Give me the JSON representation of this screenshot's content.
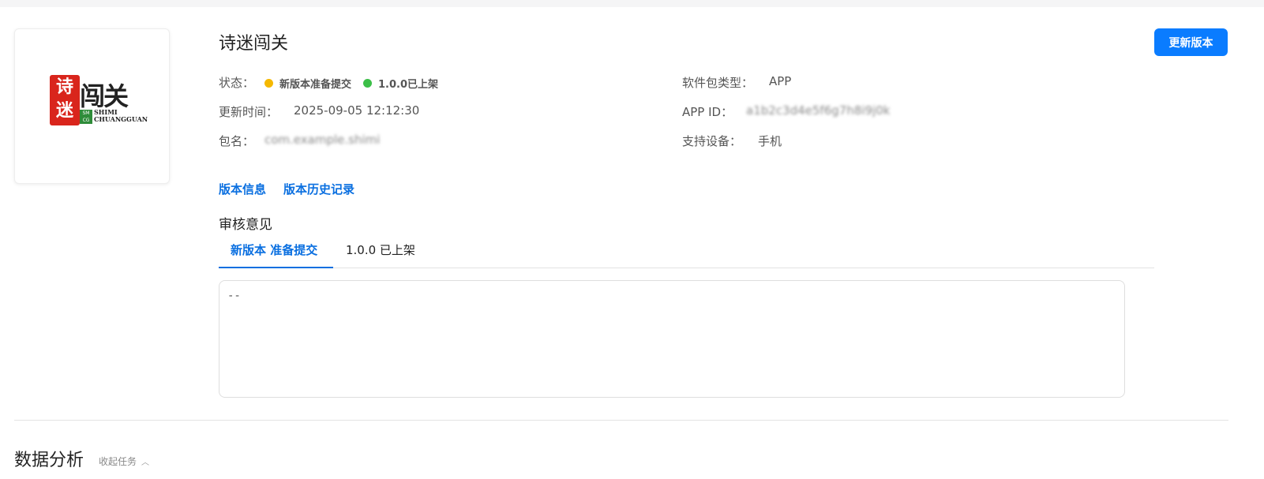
{
  "app": {
    "name": "诗迷闯关",
    "logo": {
      "seal_chars": [
        "诗",
        "迷"
      ],
      "title": "闯关",
      "mark": "SM CG",
      "sub_line1": "SHIMI",
      "sub_line2": "CHUANGGUAN"
    }
  },
  "actions": {
    "update_version": "更新版本"
  },
  "info": {
    "status_label": "状态：",
    "status_items": [
      {
        "text": "新版本准备提交",
        "color": "#f5b800"
      },
      {
        "text": "1.0.0已上架",
        "color": "#3cbf48"
      }
    ],
    "update_time_label": "更新时间：",
    "update_time_value": "2025-09-05 12:12:30",
    "package_label": "包名：",
    "package_value": "com.example.shimi",
    "package_type_label": "软件包类型：",
    "package_type_value": "APP",
    "app_id_label": "APP ID：",
    "app_id_value": "a1b2c3d4e5f6g7h8i9j0k",
    "devices_label": "支持设备：",
    "devices_value": "手机"
  },
  "links": {
    "version_info": "版本信息",
    "version_history": "版本历史记录"
  },
  "review": {
    "title": "审核意见",
    "tabs": [
      {
        "label": "新版本 准备提交",
        "active": true
      },
      {
        "label": "1.0.0 已上架",
        "active": false
      }
    ],
    "content": "--"
  },
  "analysis": {
    "title": "数据分析",
    "collapse_label": "收起任务"
  },
  "colors": {
    "accent": "#0a7cff",
    "link": "#0a6fe0"
  }
}
